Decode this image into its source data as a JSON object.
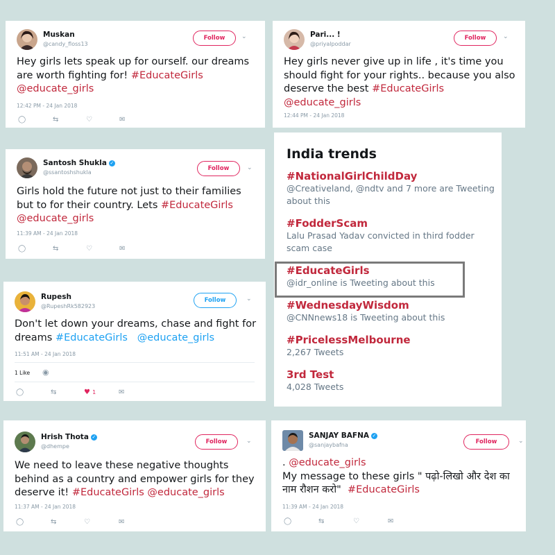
{
  "tweets": [
    {
      "name": "Muskan",
      "handle": "@candy_floss13",
      "follow": "Follow",
      "text": "Hey girls lets  speak up for ourself. our dreams are worth fighting for!",
      "hashtag": "#EducateGirls",
      "mention": "@educate_girls",
      "timestamp": "12:42 PM - 24 Jan 2018"
    },
    {
      "name": "Pari... !",
      "handle": "@priyalpoddar",
      "follow": "Follow",
      "text": "Hey girls never give up in life , it's time you should fight for your rights.. because you also deserve the best",
      "hashtag": "#EducateGirls",
      "mention": "@educate_girls",
      "timestamp": "12:44 PM - 24 Jan 2018"
    },
    {
      "name": "Santosh Shukla",
      "handle": "@ssantoshshukla",
      "follow": "Follow",
      "text": "Girls hold the future not just to their families but to for their country. Lets",
      "hashtag": "#EducateGirls",
      "mention": "@educate_girls",
      "timestamp": "11:39 AM - 24 Jan 2018"
    },
    {
      "name": "Rupesh",
      "handle": "@RupeshRk582923",
      "follow": "Follow",
      "text": "Don't let down your dreams,  chase and fight for dreams",
      "hashtag": "#EducateGirls",
      "mention": "@educate_girls",
      "timestamp": "11:51 AM - 24 Jan 2018",
      "likes_label": "1 Like",
      "like_count": "1"
    },
    {
      "name": "Hrish Thota",
      "handle": "@dhempe",
      "follow": "Follow",
      "text": "We need to leave these negative thoughts behind as a country and empower girls for they deserve it!",
      "hashtag": "#EducateGirls",
      "mention": "@educate_girls",
      "timestamp": "11:37 AM - 24 Jan 2018"
    },
    {
      "name": "SANJAY BAFNA",
      "handle": "@sanjaybafna",
      "follow": "Follow",
      "line1_prefix": ".",
      "mention": "@educate_girls",
      "text": "My message to these girls \" पढ़ो-लिखो और देश का नाम रौशन करो\"",
      "hashtag": "#EducateGirls",
      "timestamp": "11:39 AM - 24 Jan 2018"
    }
  ],
  "trends": {
    "title": "India trends",
    "items": [
      {
        "name": "#NationalGirlChildDay",
        "context": "@Creativeland, @ndtv and 7 more are Tweeting about this"
      },
      {
        "name": "#FodderScam",
        "context": "Lalu Prasad Yadav convicted in third fodder scam case"
      },
      {
        "name": "#EducateGirls",
        "context": "@idr_online is Tweeting about this"
      },
      {
        "name": "#WednesdayWisdom",
        "context": "@CNNnews18 is Tweeting about this"
      },
      {
        "name": "#PricelessMelbourne",
        "context": "2,267 Tweets"
      },
      {
        "name": "3rd Test",
        "context": "4,028 Tweets"
      }
    ]
  },
  "icons": [
    "reply-icon",
    "retweet-icon",
    "like-icon",
    "message-icon",
    "verified-icon",
    "chevron-down-icon"
  ],
  "colors": {
    "hashtag": "#c1283c",
    "twitter_blue": "#1da1f2",
    "background": "#cfe0df"
  }
}
